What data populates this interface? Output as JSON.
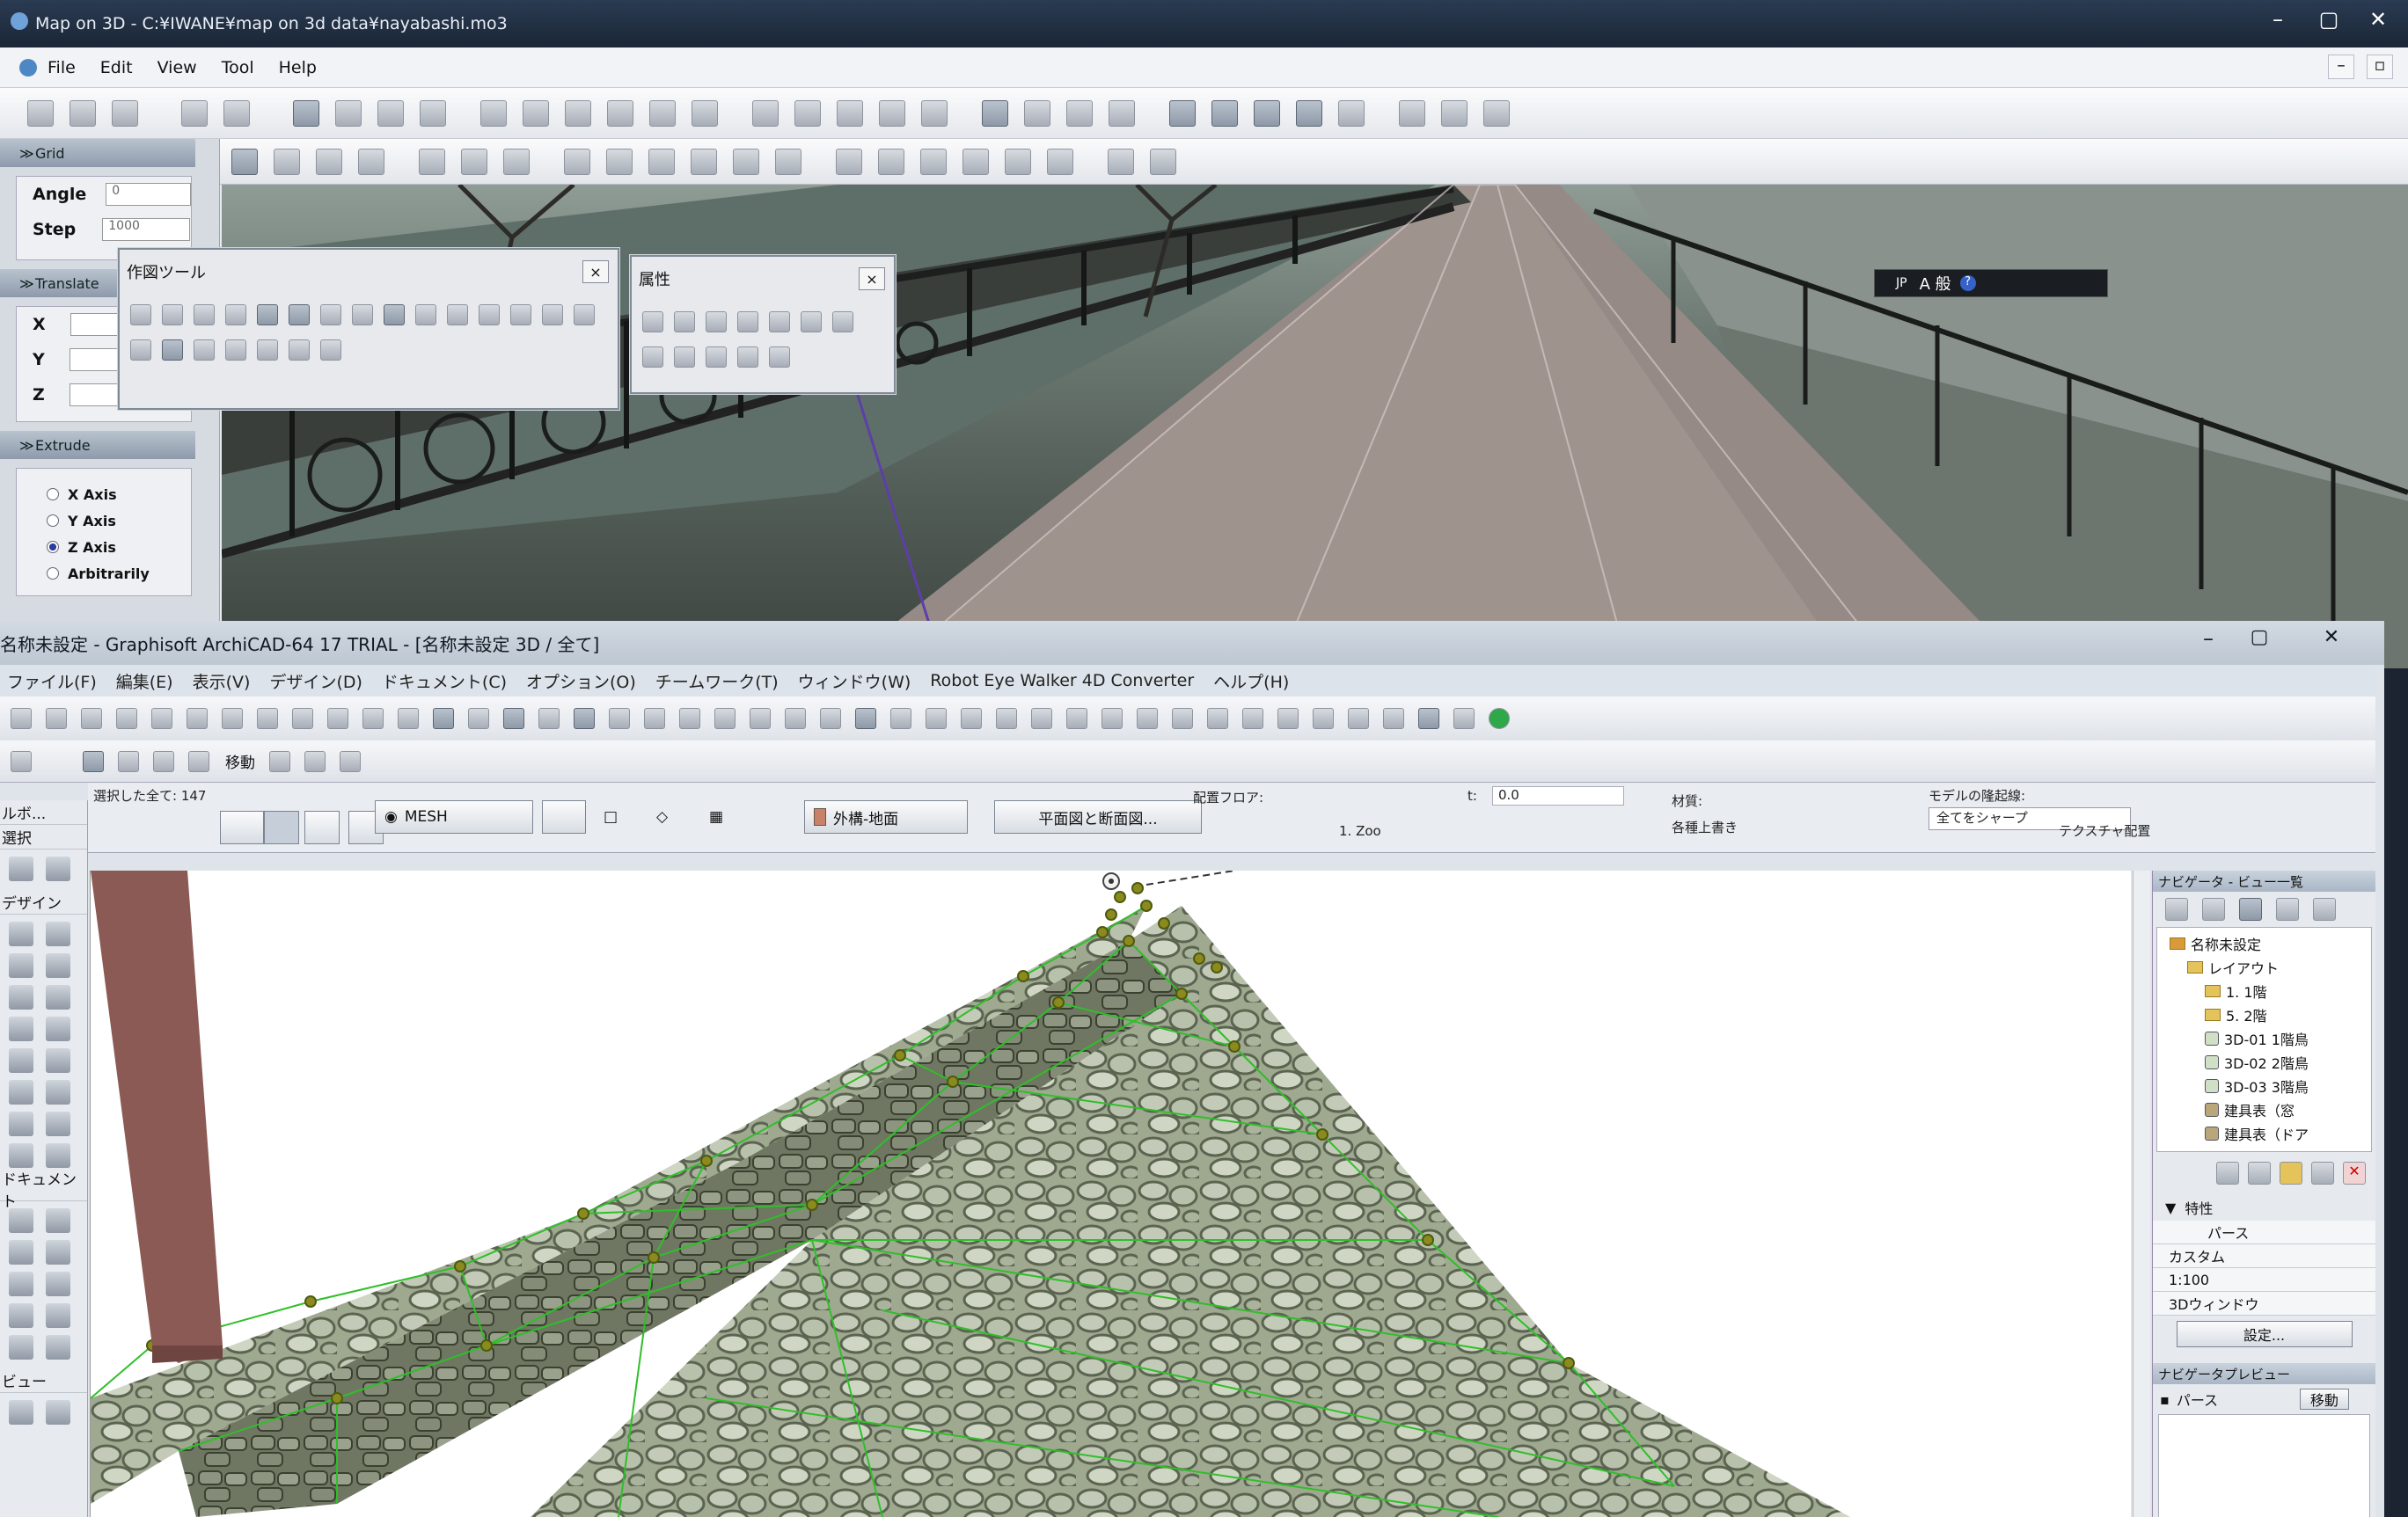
{
  "top_window": {
    "title": "Map on 3D - C:¥IWANE¥map on 3d data¥nayabashi.mo3",
    "menu": [
      "File",
      "Edit",
      "View",
      "Tool",
      "Help"
    ],
    "panels": {
      "grid": {
        "header": "Grid",
        "angle_label": "Angle",
        "angle_value": "0",
        "step_label": "Step",
        "step_value": "1000"
      },
      "translate": {
        "header": "Translate",
        "x_label": "X",
        "y_label": "Y",
        "z_label": "Z"
      },
      "extrude": {
        "header": "Extrude",
        "options": [
          "X Axis",
          "Y Axis",
          "Z Axis",
          "Arbitrarily"
        ],
        "selected": "Z Axis"
      }
    },
    "drawing_tools_palette": {
      "title": "作図ツール",
      "close": "×"
    },
    "attributes_palette": {
      "title": "属性",
      "close": "×"
    },
    "ime_bar": {
      "lang": "JP",
      "mode": "A 般"
    }
  },
  "archicad": {
    "title": "名称未設定 - Graphisoft ArchiCAD-64 17 TRIAL - [名称未設定 3D / 全て]",
    "menu": [
      "ファイル(F)",
      "編集(E)",
      "表示(V)",
      "デザイン(D)",
      "ドキュメント(C)",
      "オプション(O)",
      "チームワーク(T)",
      "ウィンドウ(W)",
      "Robot Eye Walker 4D Converter",
      "ヘルプ(H)"
    ],
    "move_label": "移動",
    "info_box": {
      "selected_label": "選択した全て: 147",
      "mesh_label": "MESH",
      "layer_label": "外構-地面",
      "plan_section_label": "平面図と断面図...",
      "floor_label": "配置フロア:",
      "floor_value": "1. Zoo",
      "t_label": "t:",
      "t_value": "0.0",
      "material_label": "材質:",
      "material_value": "各種上書き",
      "ridge_label": "モデルの隆起線:",
      "ridge_value": "全てをシャープ",
      "texture_label": "テクスチャ配置"
    },
    "toolbox": {
      "header": "ルボ...",
      "select": "選択",
      "design": "デザイン",
      "document": "ドキュメント",
      "view": "ビュー"
    },
    "navigator": {
      "header": "ナビゲータ - ビュー一覧",
      "tree": [
        "名称未設定",
        "レイアウト",
        "1. 1階",
        "5. 2階",
        "3D-01 1階鳥",
        "3D-02 2階鳥",
        "3D-03 3階鳥",
        "建具表（窓",
        "建具表（ドア"
      ],
      "properties_header": "特性",
      "prop_name": "パース",
      "prop_custom": "カスタム",
      "prop_scale": "1:100",
      "prop_window": "3Dウィンドウ",
      "settings_button": "設定...",
      "preview_header": "ナビゲータプレビュー",
      "preview_view": "パース",
      "preview_move": "移動"
    }
  }
}
